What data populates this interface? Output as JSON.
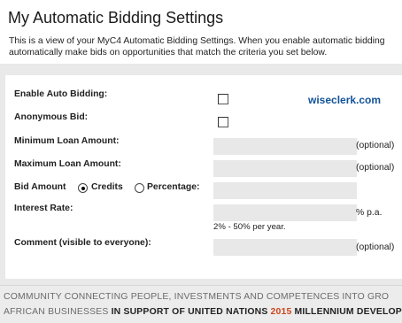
{
  "header": {
    "title": "My Automatic Bidding Settings",
    "description_line1": "This is a view of your MyC4 Automatic Bidding Settings. When you enable automatic bidding",
    "description_line2": "automatically make bids on opportunities that match the criteria you set below."
  },
  "watermark": "wiseclerk.com",
  "form": {
    "enable_auto_bidding": {
      "label": "Enable Auto Bidding:",
      "checked": false
    },
    "anonymous_bid": {
      "label": "Anonymous Bid:",
      "checked": false
    },
    "minimum_loan_amount": {
      "label": "Minimum Loan Amount:",
      "value": "",
      "hint": "(optional)"
    },
    "maximum_loan_amount": {
      "label": "Maximum Loan Amount:",
      "value": "",
      "hint": "(optional)"
    },
    "bid_amount": {
      "label": "Bid Amount",
      "options": [
        "Credits",
        "Percentage:"
      ],
      "selected": "Credits",
      "value": ""
    },
    "interest_rate": {
      "label": "Interest Rate:",
      "value": "",
      "unit": "% p.a.",
      "note": "2% - 50% per year."
    },
    "comment": {
      "label": "Comment (visible to everyone):",
      "value": "",
      "hint": "(optional)"
    }
  },
  "footer": {
    "line1": "COMMUNITY CONNECTING PEOPLE, INVESTMENTS AND COMPETENCES INTO GRO",
    "line2_prefix": "AFRICAN BUSINESSES ",
    "line2_bold1": "IN SUPPORT OF UNITED NATIONS ",
    "line2_year": "2015",
    "line2_bold2": " MILLENNIUM DEVELOP"
  },
  "colors": {
    "watermark": "#12539a",
    "year_accent": "#d0451b",
    "field_bg": "#e8e8e8"
  }
}
